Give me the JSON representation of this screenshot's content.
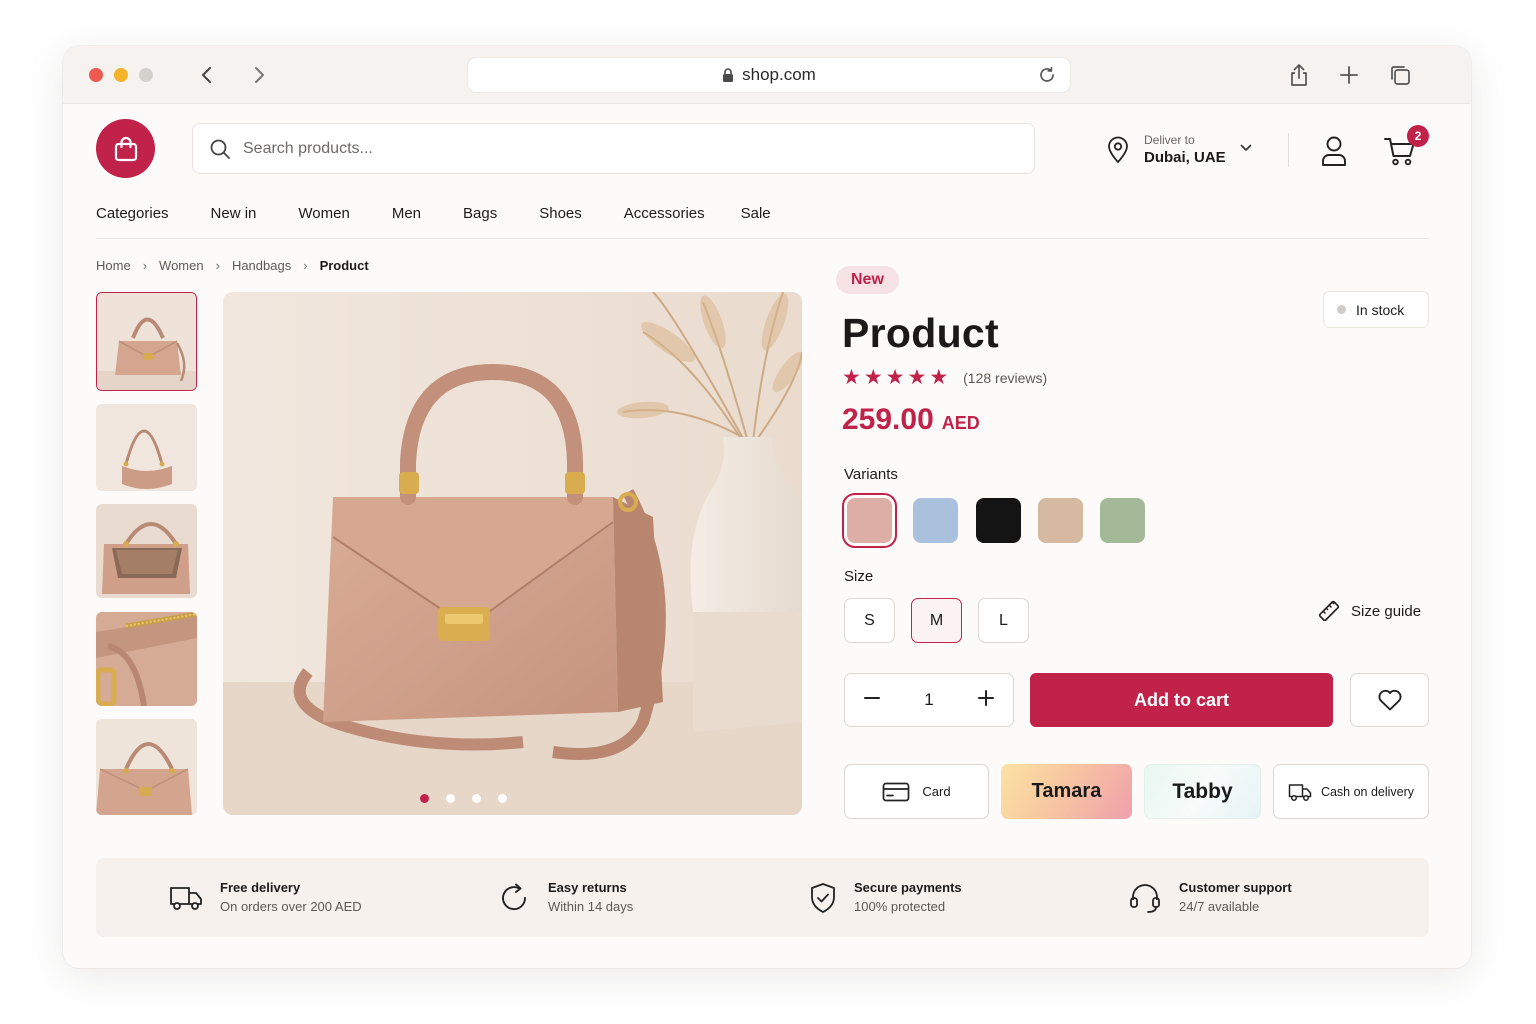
{
  "browser": {
    "url": "shop.com"
  },
  "header": {
    "search_placeholder": "Search products...",
    "deliver_label": "Deliver to",
    "deliver_location": "Dubai, UAE",
    "cart_count": "2"
  },
  "nav": [
    "Categories",
    "New in",
    "Women",
    "Men",
    "Bags",
    "Shoes",
    "Accessories",
    "Sale"
  ],
  "breadcrumb": {
    "items": [
      "Home",
      "Women",
      "Handbags"
    ],
    "current": "Product"
  },
  "gallery": {
    "thumbnail_count": 5,
    "active_thumbnail": 0,
    "dot_count": 4,
    "active_dot": 0
  },
  "product": {
    "badge": "New",
    "stock_status": "In stock",
    "title": "Product",
    "rating": 5,
    "reviews": "(128 reviews)",
    "price": "259.00",
    "currency": "AED",
    "variants_label": "Variants",
    "variants": [
      {
        "color": "#dcaea6",
        "selected": true
      },
      {
        "color": "#a9c1dc",
        "selected": false
      },
      {
        "color": "#141414",
        "selected": false
      },
      {
        "color": "#d5b9a1",
        "selected": false
      },
      {
        "color": "#a4b998",
        "selected": false
      }
    ],
    "size_label": "Size",
    "sizes": [
      "S",
      "M",
      "L"
    ],
    "selected_size": "M",
    "size_guide": "Size guide",
    "quantity": "1",
    "add_to_cart": "Add to cart"
  },
  "payments": {
    "card": "Card",
    "tamara": "Tamara",
    "tabby": "Tabby",
    "cod": "Cash on delivery"
  },
  "features": [
    {
      "title": "Free delivery",
      "subtitle": "On orders over 200 AED",
      "icon": "truck-icon"
    },
    {
      "title": "Easy returns",
      "subtitle": "Within 14 days",
      "icon": "returns-icon"
    },
    {
      "title": "Secure payments",
      "subtitle": "100% protected",
      "icon": "shield-check-icon"
    },
    {
      "title": "Customer support",
      "subtitle": "24/7 available",
      "icon": "headset-icon"
    }
  ],
  "colors": {
    "accent": "#c0224a",
    "background": "#fdfbf9"
  }
}
